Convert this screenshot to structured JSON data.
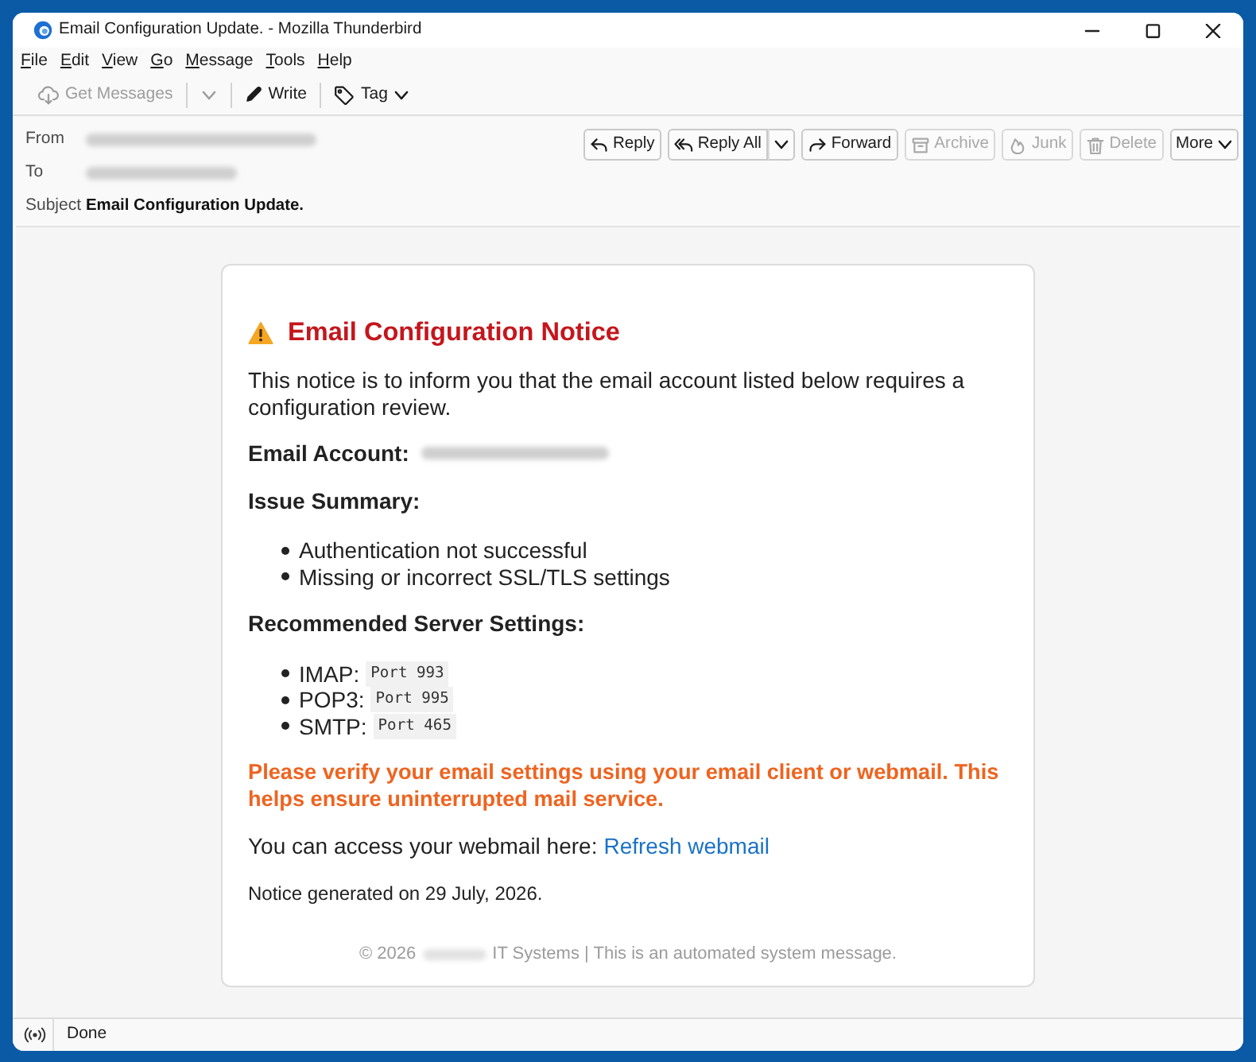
{
  "window": {
    "title": "Email Configuration Update. - Mozilla Thunderbird"
  },
  "menu_bar": [
    "File",
    "Edit",
    "View",
    "Go",
    "Message",
    "Tools",
    "Help"
  ],
  "toolbar": [
    {
      "label": "Get Messages",
      "disabled": true,
      "split_menu": true
    },
    {
      "label": "Write",
      "disabled": false
    },
    {
      "label": "Tag",
      "disabled": false,
      "menu": true
    }
  ],
  "header": {
    "fields": [
      {
        "label": "From",
        "redacted": true
      },
      {
        "label": "To",
        "redacted": true
      },
      {
        "label": "Subject",
        "value": "Email Configuration Update."
      }
    ],
    "actions": [
      {
        "label": "Reply",
        "disabled": false
      },
      {
        "label": "Reply All",
        "disabled": false,
        "split_menu": true
      },
      {
        "label": "Forward",
        "disabled": false
      },
      {
        "label": "Archive",
        "disabled": true
      },
      {
        "label": "Junk",
        "disabled": true
      },
      {
        "label": "Delete",
        "disabled": true
      },
      {
        "label": "More",
        "disabled": false,
        "menu": true
      }
    ]
  },
  "message": {
    "heading": "Email Configuration Notice",
    "intro": "This notice is to inform you that the email account listed below requires a configuration review.",
    "account": {
      "label": "Email Account:",
      "redacted": true
    },
    "sections": [
      {
        "title": "Issue Summary:",
        "items": [
          {
            "text": "Authentication not successful"
          },
          {
            "text": "Missing or incorrect SSL/TLS settings"
          }
        ]
      },
      {
        "title": "Recommended Server Settings:",
        "items": [
          {
            "text": "IMAP:",
            "code": "Port 993"
          },
          {
            "text": "POP3:",
            "code": "Port 995"
          },
          {
            "text": "SMTP:",
            "code": "Port 465"
          }
        ]
      }
    ],
    "warning": "Please verify your email settings using your email client or webmail. This helps ensure uninterrupted mail service.",
    "webmail": {
      "text": "You can access your webmail here:",
      "link": "Refresh webmail"
    },
    "generated": "Notice generated on 29 July, 2026.",
    "footer": {
      "before": "© 2026",
      "redacted": true,
      "after": "IT Systems | This is an automated system message."
    }
  },
  "status_bar": {
    "text": "Done"
  }
}
